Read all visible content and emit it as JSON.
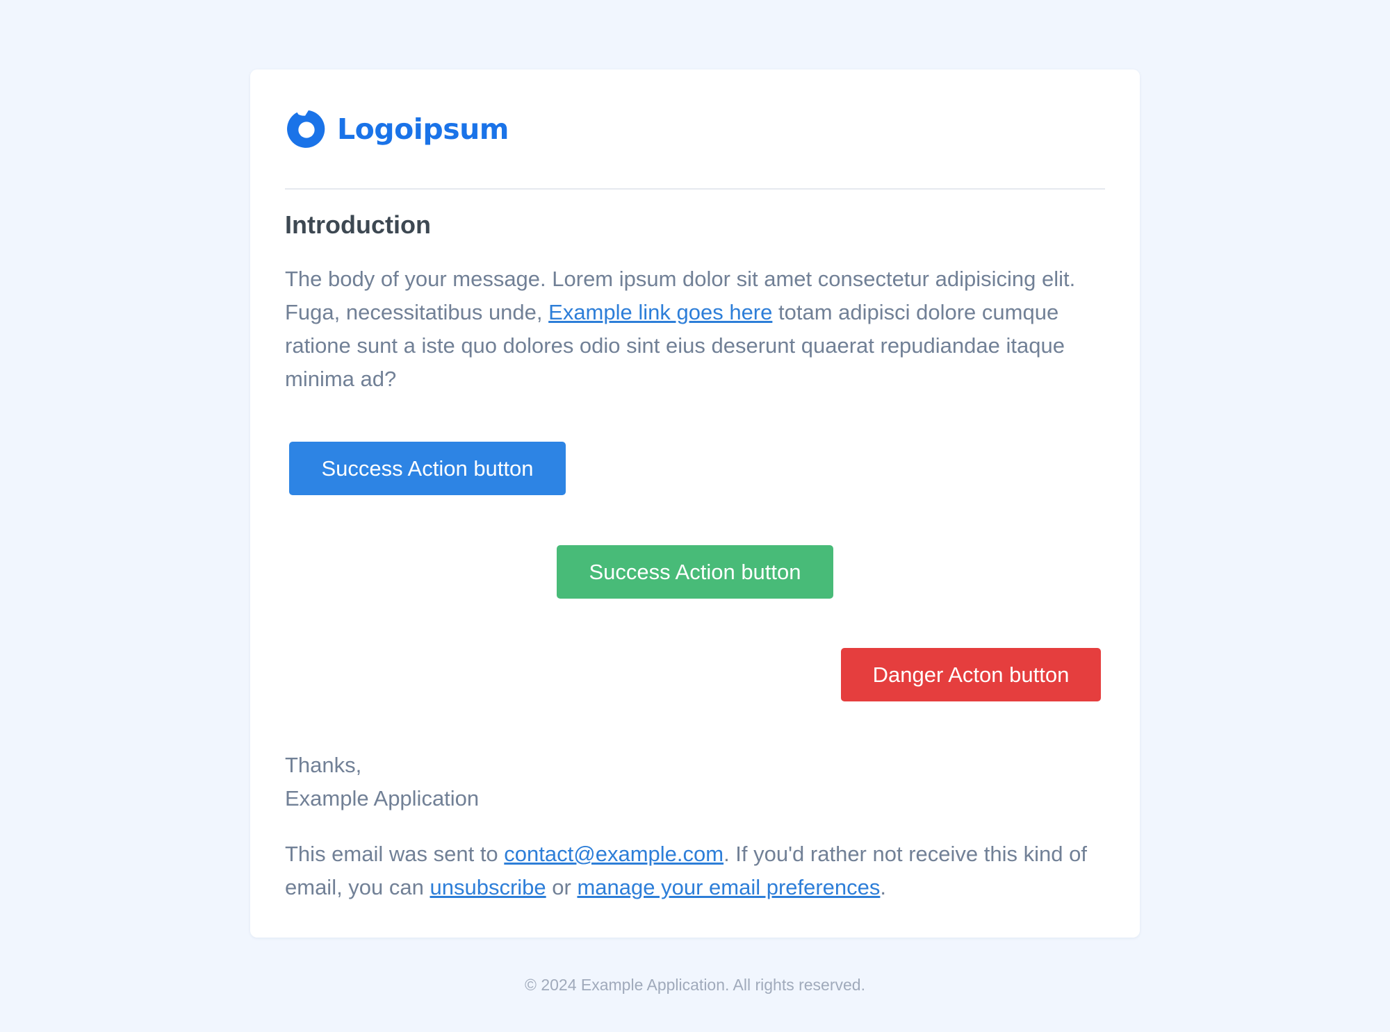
{
  "brand": {
    "name": "Logoipsum",
    "color": "#1a73e8"
  },
  "content": {
    "heading": "Introduction",
    "body_before_link": "The body of your message. Lorem ipsum dolor sit amet consectetur adipisicing elit. Fuga, necessitatibus unde, ",
    "body_link": "Example link goes here",
    "body_after_link": " totam adipisci dolore cumque ratione sunt a iste quo dolores odio sint eius deserunt quaerat repudiandae itaque minima ad?"
  },
  "buttons": {
    "primary": {
      "label": "Success Action button",
      "color": "#2d84e4"
    },
    "success": {
      "label": "Success Action button",
      "color": "#48bb78"
    },
    "danger": {
      "label": "Danger Acton button",
      "color": "#e53e3e"
    }
  },
  "signoff": {
    "line1": "Thanks,",
    "line2": "Example Application"
  },
  "footer_note": {
    "before_email": "This email was sent to ",
    "email": "contact@example.com",
    "after_email": ". If you'd rather not receive this kind of email, you can ",
    "unsubscribe": "unsubscribe",
    "or": " or ",
    "preferences": "manage your email preferences",
    "end": "."
  },
  "copyright": "© 2024 Example Application. All rights reserved.",
  "colors": {
    "page_background": "#f1f6fe",
    "card_background": "#ffffff",
    "link": "#2d7ed8",
    "body_text": "#718096",
    "heading_text": "#3d4852"
  }
}
